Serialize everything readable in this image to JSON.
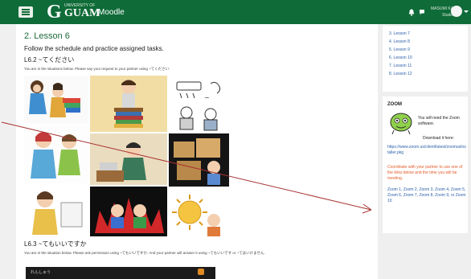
{
  "header": {
    "logo_g": "G",
    "logo_university": "UNIVERSITY OF",
    "logo_guam": "GUAM",
    "moodle_label": "Moodle",
    "user_name": "MASUMI KAI",
    "user_role": "Student"
  },
  "main": {
    "page_title": "2. Lesson 6",
    "instruction": "Follow the schedule and practice assigned tasks.",
    "section1": {
      "heading": "L6.2 ~てください",
      "note": "You are in the situations below.  Please say your request to your partner using ~てください."
    },
    "section2": {
      "heading": "L6.3 ~てもいいですか",
      "note": "You are in the situation below.  Please ask permission using ~てもいいですか.  And your partner will answer it using ~てもいいです or ~てはいけません."
    },
    "strip_label": "れんしゅう"
  },
  "sidebar": {
    "lessons": [
      {
        "label": "3. Lesson 7"
      },
      {
        "label": "4. Lesson 8"
      },
      {
        "label": "5. Lesson 9"
      },
      {
        "label": "6. Lesson 10"
      },
      {
        "label": "7. Lesson 11"
      },
      {
        "label": "8. Lesson 12"
      }
    ],
    "zoom": {
      "title": "ZOOM",
      "need_software": "You will need the Zoom software.",
      "download": "Download it here:",
      "url": "https://www.zoom.us/client/latest/zoomusInstaller.pkg",
      "coordinate": "Coordinate with your partner to use one of the links below and the time you will be meeting.",
      "links": "Zoom 1, Zoom 2, Zoom 3, Zoom 4, Zoom 5, Zoom 6, Zoom 7, Zoom 8, Zoom 9, or Zoom 10"
    }
  },
  "colors": {
    "header_green": "#0f6b38",
    "link_blue": "#2a5fa8",
    "coord_orange": "#e25c2a",
    "annotation_red": "#a83232"
  },
  "icons": [
    "menu-icon",
    "bell-icon",
    "chat-icon",
    "avatar-icon",
    "zoom-mascot-icon"
  ]
}
